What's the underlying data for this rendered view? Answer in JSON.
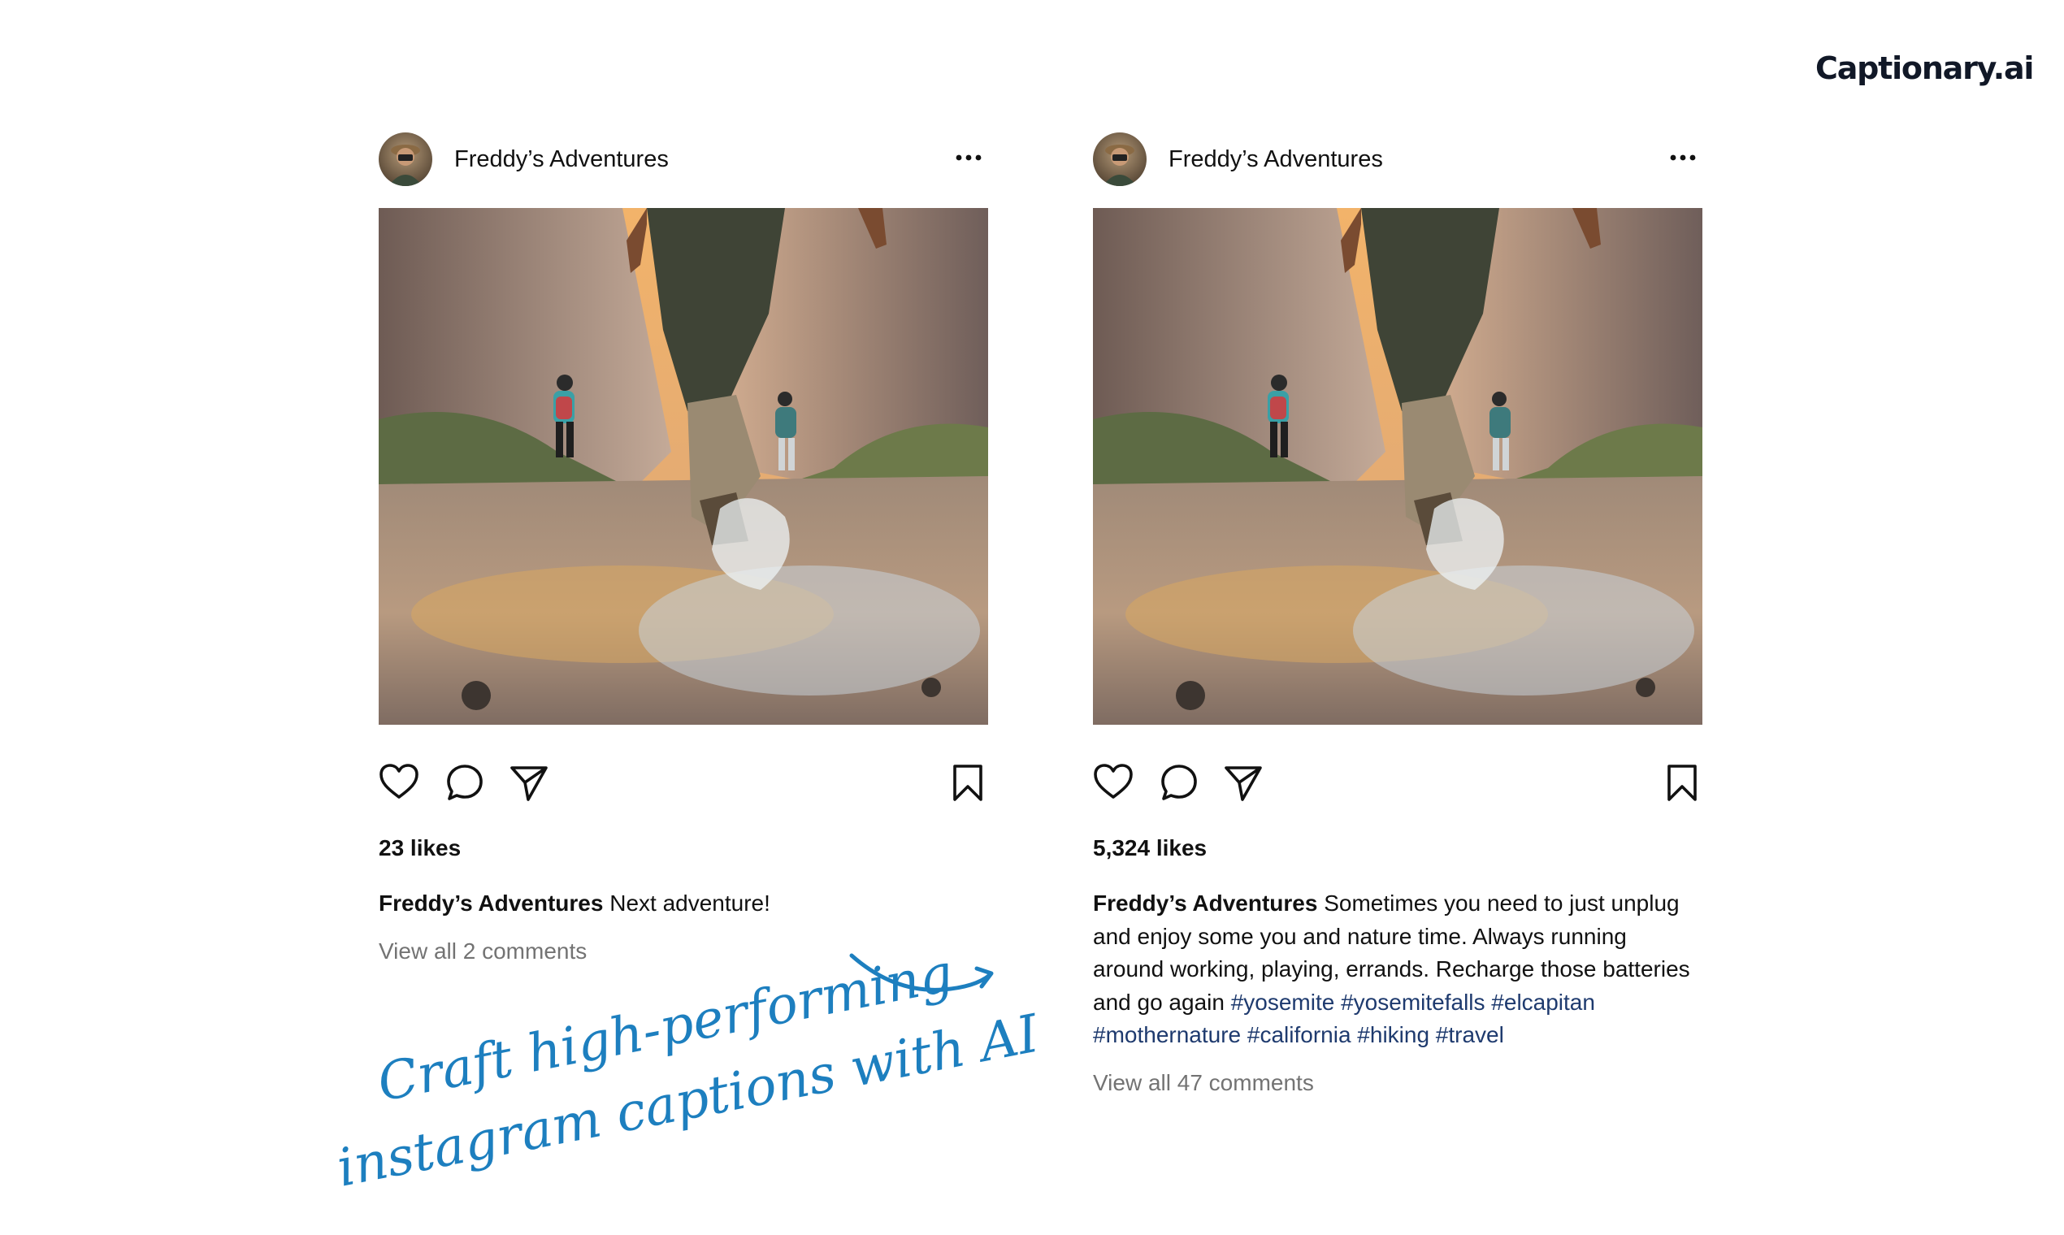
{
  "brand": "Captionary.ai",
  "posts": [
    {
      "username": "Freddy’s Adventures",
      "likes": "23 likes",
      "caption_user": "Freddy’s Adventures",
      "caption_text": " Next adventure!",
      "hashtags": "",
      "comments_link": "View all 2 comments"
    },
    {
      "username": "Freddy’s Adventures",
      "likes": "5,324 likes",
      "caption_user": "Freddy’s Adventures",
      "caption_text": " Sometimes you need to just unplug and enjoy some you and nature time. Always running around working, playing, errands. Recharge those batteries and go again ",
      "hashtags": "#yosemite #yosemitefalls #elcapitan #mothernature #california #hiking #travel",
      "comments_link": "View all 47 comments"
    }
  ],
  "icons": {
    "more": "more-options-icon",
    "like": "heart-icon",
    "comment": "comment-bubble-icon",
    "share": "paper-plane-icon",
    "save": "bookmark-icon",
    "arrow": "curved-arrow-icon"
  },
  "tagline": {
    "line1": "Craft high-performing",
    "line2": "instagram captions with AI"
  },
  "colors": {
    "hashtag": "#1e3a6e",
    "tagline": "#1d7fbf",
    "muted_text": "#737373",
    "brand_text": "#111827"
  }
}
